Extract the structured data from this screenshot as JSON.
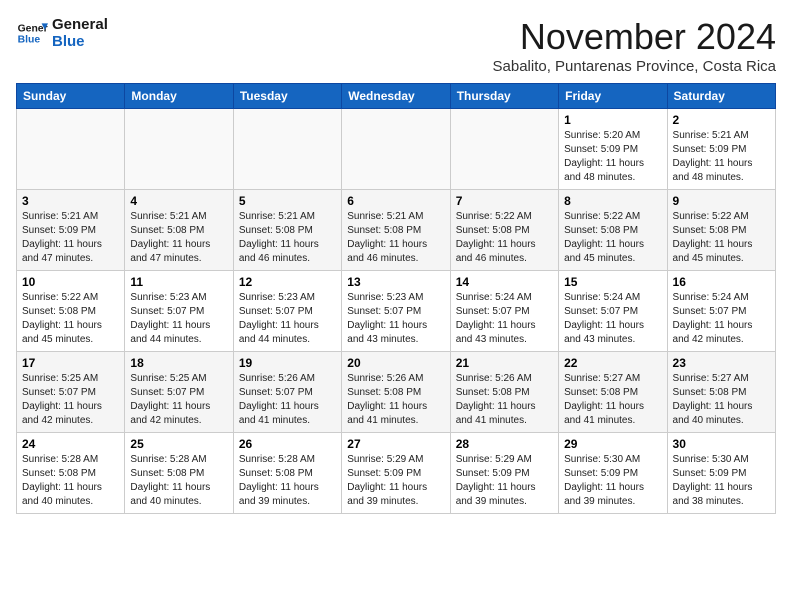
{
  "logo": {
    "line1": "General",
    "line2": "Blue"
  },
  "header": {
    "month": "November 2024",
    "location": "Sabalito, Puntarenas Province, Costa Rica"
  },
  "weekdays": [
    "Sunday",
    "Monday",
    "Tuesday",
    "Wednesday",
    "Thursday",
    "Friday",
    "Saturday"
  ],
  "weeks": [
    [
      {
        "day": "",
        "info": ""
      },
      {
        "day": "",
        "info": ""
      },
      {
        "day": "",
        "info": ""
      },
      {
        "day": "",
        "info": ""
      },
      {
        "day": "",
        "info": ""
      },
      {
        "day": "1",
        "info": "Sunrise: 5:20 AM\nSunset: 5:09 PM\nDaylight: 11 hours and 48 minutes."
      },
      {
        "day": "2",
        "info": "Sunrise: 5:21 AM\nSunset: 5:09 PM\nDaylight: 11 hours and 48 minutes."
      }
    ],
    [
      {
        "day": "3",
        "info": "Sunrise: 5:21 AM\nSunset: 5:09 PM\nDaylight: 11 hours and 47 minutes."
      },
      {
        "day": "4",
        "info": "Sunrise: 5:21 AM\nSunset: 5:08 PM\nDaylight: 11 hours and 47 minutes."
      },
      {
        "day": "5",
        "info": "Sunrise: 5:21 AM\nSunset: 5:08 PM\nDaylight: 11 hours and 46 minutes."
      },
      {
        "day": "6",
        "info": "Sunrise: 5:21 AM\nSunset: 5:08 PM\nDaylight: 11 hours and 46 minutes."
      },
      {
        "day": "7",
        "info": "Sunrise: 5:22 AM\nSunset: 5:08 PM\nDaylight: 11 hours and 46 minutes."
      },
      {
        "day": "8",
        "info": "Sunrise: 5:22 AM\nSunset: 5:08 PM\nDaylight: 11 hours and 45 minutes."
      },
      {
        "day": "9",
        "info": "Sunrise: 5:22 AM\nSunset: 5:08 PM\nDaylight: 11 hours and 45 minutes."
      }
    ],
    [
      {
        "day": "10",
        "info": "Sunrise: 5:22 AM\nSunset: 5:08 PM\nDaylight: 11 hours and 45 minutes."
      },
      {
        "day": "11",
        "info": "Sunrise: 5:23 AM\nSunset: 5:07 PM\nDaylight: 11 hours and 44 minutes."
      },
      {
        "day": "12",
        "info": "Sunrise: 5:23 AM\nSunset: 5:07 PM\nDaylight: 11 hours and 44 minutes."
      },
      {
        "day": "13",
        "info": "Sunrise: 5:23 AM\nSunset: 5:07 PM\nDaylight: 11 hours and 43 minutes."
      },
      {
        "day": "14",
        "info": "Sunrise: 5:24 AM\nSunset: 5:07 PM\nDaylight: 11 hours and 43 minutes."
      },
      {
        "day": "15",
        "info": "Sunrise: 5:24 AM\nSunset: 5:07 PM\nDaylight: 11 hours and 43 minutes."
      },
      {
        "day": "16",
        "info": "Sunrise: 5:24 AM\nSunset: 5:07 PM\nDaylight: 11 hours and 42 minutes."
      }
    ],
    [
      {
        "day": "17",
        "info": "Sunrise: 5:25 AM\nSunset: 5:07 PM\nDaylight: 11 hours and 42 minutes."
      },
      {
        "day": "18",
        "info": "Sunrise: 5:25 AM\nSunset: 5:07 PM\nDaylight: 11 hours and 42 minutes."
      },
      {
        "day": "19",
        "info": "Sunrise: 5:26 AM\nSunset: 5:07 PM\nDaylight: 11 hours and 41 minutes."
      },
      {
        "day": "20",
        "info": "Sunrise: 5:26 AM\nSunset: 5:08 PM\nDaylight: 11 hours and 41 minutes."
      },
      {
        "day": "21",
        "info": "Sunrise: 5:26 AM\nSunset: 5:08 PM\nDaylight: 11 hours and 41 minutes."
      },
      {
        "day": "22",
        "info": "Sunrise: 5:27 AM\nSunset: 5:08 PM\nDaylight: 11 hours and 41 minutes."
      },
      {
        "day": "23",
        "info": "Sunrise: 5:27 AM\nSunset: 5:08 PM\nDaylight: 11 hours and 40 minutes."
      }
    ],
    [
      {
        "day": "24",
        "info": "Sunrise: 5:28 AM\nSunset: 5:08 PM\nDaylight: 11 hours and 40 minutes."
      },
      {
        "day": "25",
        "info": "Sunrise: 5:28 AM\nSunset: 5:08 PM\nDaylight: 11 hours and 40 minutes."
      },
      {
        "day": "26",
        "info": "Sunrise: 5:28 AM\nSunset: 5:08 PM\nDaylight: 11 hours and 39 minutes."
      },
      {
        "day": "27",
        "info": "Sunrise: 5:29 AM\nSunset: 5:09 PM\nDaylight: 11 hours and 39 minutes."
      },
      {
        "day": "28",
        "info": "Sunrise: 5:29 AM\nSunset: 5:09 PM\nDaylight: 11 hours and 39 minutes."
      },
      {
        "day": "29",
        "info": "Sunrise: 5:30 AM\nSunset: 5:09 PM\nDaylight: 11 hours and 39 minutes."
      },
      {
        "day": "30",
        "info": "Sunrise: 5:30 AM\nSunset: 5:09 PM\nDaylight: 11 hours and 38 minutes."
      }
    ]
  ]
}
